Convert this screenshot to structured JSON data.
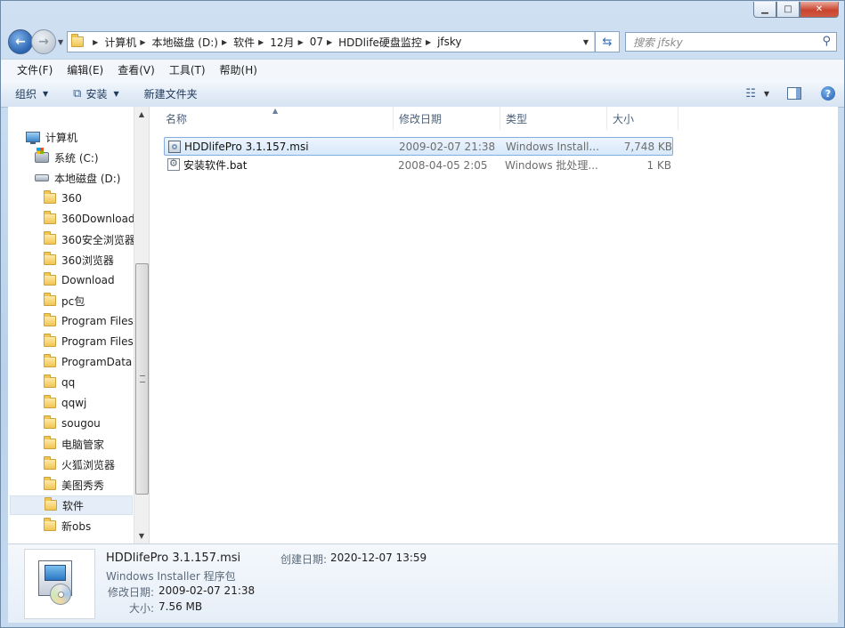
{
  "window": {
    "caption_buttons": [
      "minimize",
      "maximize",
      "close"
    ]
  },
  "address_bar": {
    "crumbs": [
      "计算机",
      "本地磁盘 (D:)",
      "软件",
      "12月",
      "07",
      "HDDlife硬盘监控",
      "jfsky"
    ],
    "search_placeholder": "搜索 jfsky"
  },
  "menu": [
    "文件(F)",
    "编辑(E)",
    "查看(V)",
    "工具(T)",
    "帮助(H)"
  ],
  "toolbar": {
    "organize": "组织",
    "install": "安装",
    "new_folder": "新建文件夹"
  },
  "nav_tree": {
    "computer": "计算机",
    "system_drive": "系统 (C:)",
    "local_disk": "本地磁盘 (D:)",
    "folders": [
      "360",
      "360Download",
      "360安全浏览器",
      "360浏览器",
      "Download",
      "pc包",
      "Program Files",
      "Program Files",
      "ProgramData",
      "qq",
      "qqwj",
      "sougou",
      "电脑管家",
      "火狐浏览器",
      "美图秀秀",
      "软件",
      "新obs"
    ],
    "selected_folder": "软件"
  },
  "columns": {
    "name": "名称",
    "date": "修改日期",
    "type": "类型",
    "size": "大小"
  },
  "files": [
    {
      "name": "HDDlifePro 3.1.157.msi",
      "date": "2009-02-07 21:38",
      "type": "Windows Install...",
      "size": "7,748 KB",
      "icon": "msi-installer-icon",
      "selected": true
    },
    {
      "name": "安装软件.bat",
      "date": "2008-04-05 2:05",
      "type": "Windows 批处理...",
      "size": "1 KB",
      "icon": "batch-file-icon",
      "selected": false
    }
  ],
  "details": {
    "name": "HDDlifePro 3.1.157.msi",
    "type": "Windows Installer 程序包",
    "modified_label": "修改日期:",
    "modified_value": "2009-02-07 21:38",
    "size_label": "大小:",
    "size_value": "7.56 MB",
    "created_label": "创建日期:",
    "created_value": "2020-12-07 13:59"
  }
}
